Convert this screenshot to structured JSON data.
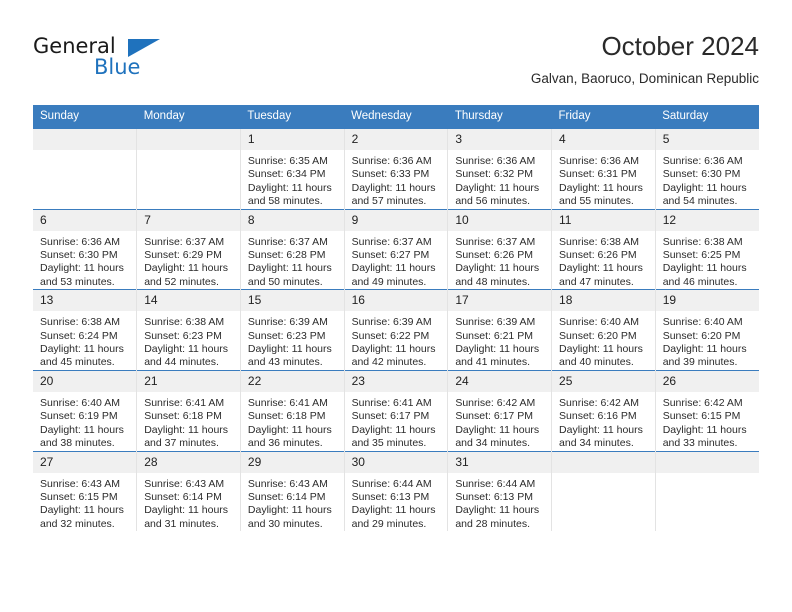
{
  "brand": {
    "name_part1": "General",
    "name_part2": "Blue",
    "triangle_icon": "triangle-icon",
    "accent_color": "#1f72bd"
  },
  "header": {
    "title": "October 2024",
    "subtitle": "Galvan, Baoruco, Dominican Republic"
  },
  "theme": {
    "header_blue": "#3a7cbe",
    "daynum_band": "#f0f0f0",
    "grid_line": "#e3e3e3"
  },
  "weekdays": [
    "Sunday",
    "Monday",
    "Tuesday",
    "Wednesday",
    "Thursday",
    "Friday",
    "Saturday"
  ],
  "weeks": [
    [
      {
        "day": "",
        "sunrise": "",
        "sunset": "",
        "daylight1": "",
        "daylight2": ""
      },
      {
        "day": "",
        "sunrise": "",
        "sunset": "",
        "daylight1": "",
        "daylight2": ""
      },
      {
        "day": "1",
        "sunrise": "Sunrise: 6:35 AM",
        "sunset": "Sunset: 6:34 PM",
        "daylight1": "Daylight: 11 hours",
        "daylight2": "and 58 minutes."
      },
      {
        "day": "2",
        "sunrise": "Sunrise: 6:36 AM",
        "sunset": "Sunset: 6:33 PM",
        "daylight1": "Daylight: 11 hours",
        "daylight2": "and 57 minutes."
      },
      {
        "day": "3",
        "sunrise": "Sunrise: 6:36 AM",
        "sunset": "Sunset: 6:32 PM",
        "daylight1": "Daylight: 11 hours",
        "daylight2": "and 56 minutes."
      },
      {
        "day": "4",
        "sunrise": "Sunrise: 6:36 AM",
        "sunset": "Sunset: 6:31 PM",
        "daylight1": "Daylight: 11 hours",
        "daylight2": "and 55 minutes."
      },
      {
        "day": "5",
        "sunrise": "Sunrise: 6:36 AM",
        "sunset": "Sunset: 6:30 PM",
        "daylight1": "Daylight: 11 hours",
        "daylight2": "and 54 minutes."
      }
    ],
    [
      {
        "day": "6",
        "sunrise": "Sunrise: 6:36 AM",
        "sunset": "Sunset: 6:30 PM",
        "daylight1": "Daylight: 11 hours",
        "daylight2": "and 53 minutes."
      },
      {
        "day": "7",
        "sunrise": "Sunrise: 6:37 AM",
        "sunset": "Sunset: 6:29 PM",
        "daylight1": "Daylight: 11 hours",
        "daylight2": "and 52 minutes."
      },
      {
        "day": "8",
        "sunrise": "Sunrise: 6:37 AM",
        "sunset": "Sunset: 6:28 PM",
        "daylight1": "Daylight: 11 hours",
        "daylight2": "and 50 minutes."
      },
      {
        "day": "9",
        "sunrise": "Sunrise: 6:37 AM",
        "sunset": "Sunset: 6:27 PM",
        "daylight1": "Daylight: 11 hours",
        "daylight2": "and 49 minutes."
      },
      {
        "day": "10",
        "sunrise": "Sunrise: 6:37 AM",
        "sunset": "Sunset: 6:26 PM",
        "daylight1": "Daylight: 11 hours",
        "daylight2": "and 48 minutes."
      },
      {
        "day": "11",
        "sunrise": "Sunrise: 6:38 AM",
        "sunset": "Sunset: 6:26 PM",
        "daylight1": "Daylight: 11 hours",
        "daylight2": "and 47 minutes."
      },
      {
        "day": "12",
        "sunrise": "Sunrise: 6:38 AM",
        "sunset": "Sunset: 6:25 PM",
        "daylight1": "Daylight: 11 hours",
        "daylight2": "and 46 minutes."
      }
    ],
    [
      {
        "day": "13",
        "sunrise": "Sunrise: 6:38 AM",
        "sunset": "Sunset: 6:24 PM",
        "daylight1": "Daylight: 11 hours",
        "daylight2": "and 45 minutes."
      },
      {
        "day": "14",
        "sunrise": "Sunrise: 6:38 AM",
        "sunset": "Sunset: 6:23 PM",
        "daylight1": "Daylight: 11 hours",
        "daylight2": "and 44 minutes."
      },
      {
        "day": "15",
        "sunrise": "Sunrise: 6:39 AM",
        "sunset": "Sunset: 6:23 PM",
        "daylight1": "Daylight: 11 hours",
        "daylight2": "and 43 minutes."
      },
      {
        "day": "16",
        "sunrise": "Sunrise: 6:39 AM",
        "sunset": "Sunset: 6:22 PM",
        "daylight1": "Daylight: 11 hours",
        "daylight2": "and 42 minutes."
      },
      {
        "day": "17",
        "sunrise": "Sunrise: 6:39 AM",
        "sunset": "Sunset: 6:21 PM",
        "daylight1": "Daylight: 11 hours",
        "daylight2": "and 41 minutes."
      },
      {
        "day": "18",
        "sunrise": "Sunrise: 6:40 AM",
        "sunset": "Sunset: 6:20 PM",
        "daylight1": "Daylight: 11 hours",
        "daylight2": "and 40 minutes."
      },
      {
        "day": "19",
        "sunrise": "Sunrise: 6:40 AM",
        "sunset": "Sunset: 6:20 PM",
        "daylight1": "Daylight: 11 hours",
        "daylight2": "and 39 minutes."
      }
    ],
    [
      {
        "day": "20",
        "sunrise": "Sunrise: 6:40 AM",
        "sunset": "Sunset: 6:19 PM",
        "daylight1": "Daylight: 11 hours",
        "daylight2": "and 38 minutes."
      },
      {
        "day": "21",
        "sunrise": "Sunrise: 6:41 AM",
        "sunset": "Sunset: 6:18 PM",
        "daylight1": "Daylight: 11 hours",
        "daylight2": "and 37 minutes."
      },
      {
        "day": "22",
        "sunrise": "Sunrise: 6:41 AM",
        "sunset": "Sunset: 6:18 PM",
        "daylight1": "Daylight: 11 hours",
        "daylight2": "and 36 minutes."
      },
      {
        "day": "23",
        "sunrise": "Sunrise: 6:41 AM",
        "sunset": "Sunset: 6:17 PM",
        "daylight1": "Daylight: 11 hours",
        "daylight2": "and 35 minutes."
      },
      {
        "day": "24",
        "sunrise": "Sunrise: 6:42 AM",
        "sunset": "Sunset: 6:17 PM",
        "daylight1": "Daylight: 11 hours",
        "daylight2": "and 34 minutes."
      },
      {
        "day": "25",
        "sunrise": "Sunrise: 6:42 AM",
        "sunset": "Sunset: 6:16 PM",
        "daylight1": "Daylight: 11 hours",
        "daylight2": "and 34 minutes."
      },
      {
        "day": "26",
        "sunrise": "Sunrise: 6:42 AM",
        "sunset": "Sunset: 6:15 PM",
        "daylight1": "Daylight: 11 hours",
        "daylight2": "and 33 minutes."
      }
    ],
    [
      {
        "day": "27",
        "sunrise": "Sunrise: 6:43 AM",
        "sunset": "Sunset: 6:15 PM",
        "daylight1": "Daylight: 11 hours",
        "daylight2": "and 32 minutes."
      },
      {
        "day": "28",
        "sunrise": "Sunrise: 6:43 AM",
        "sunset": "Sunset: 6:14 PM",
        "daylight1": "Daylight: 11 hours",
        "daylight2": "and 31 minutes."
      },
      {
        "day": "29",
        "sunrise": "Sunrise: 6:43 AM",
        "sunset": "Sunset: 6:14 PM",
        "daylight1": "Daylight: 11 hours",
        "daylight2": "and 30 minutes."
      },
      {
        "day": "30",
        "sunrise": "Sunrise: 6:44 AM",
        "sunset": "Sunset: 6:13 PM",
        "daylight1": "Daylight: 11 hours",
        "daylight2": "and 29 minutes."
      },
      {
        "day": "31",
        "sunrise": "Sunrise: 6:44 AM",
        "sunset": "Sunset: 6:13 PM",
        "daylight1": "Daylight: 11 hours",
        "daylight2": "and 28 minutes."
      },
      {
        "day": "",
        "sunrise": "",
        "sunset": "",
        "daylight1": "",
        "daylight2": ""
      },
      {
        "day": "",
        "sunrise": "",
        "sunset": "",
        "daylight1": "",
        "daylight2": ""
      }
    ]
  ]
}
